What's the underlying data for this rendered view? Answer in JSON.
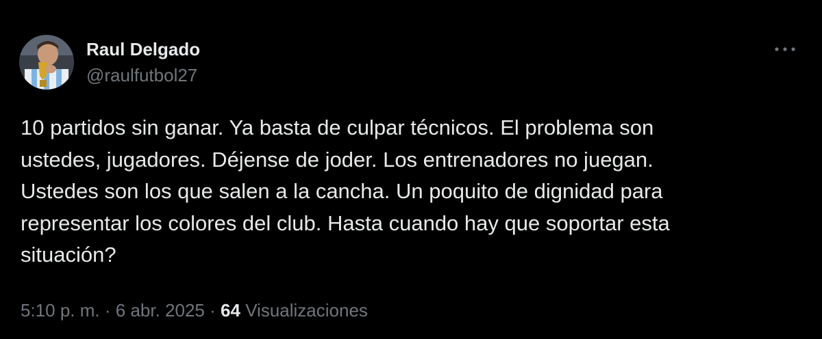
{
  "author": {
    "name": "Raul Delgado",
    "handle": "@raulfutbol27",
    "avatar_icon": "avatar-photo-player-kissing-trophy"
  },
  "more_icon": "more-horizontal-icon",
  "tweet": {
    "lines": [
      "10 partidos sin ganar. Ya basta de culpar técnicos. El problema son",
      "ustedes, jugadores. Déjense de joder. Los entrenadores no juegan.",
      "Ustedes son los que salen a la cancha. Un poquito de dignidad para",
      "representar los colores del club. Hasta cuando hay que soportar esta",
      "situación?"
    ]
  },
  "meta": {
    "time": "5:10 p. m.",
    "separator": "·",
    "date": "6 abr. 2025",
    "views_count": "64",
    "views_label": "Visualizaciones"
  },
  "colors": {
    "background": "#000000",
    "primary_text": "#e7e9ea",
    "secondary_text": "#71767b"
  }
}
